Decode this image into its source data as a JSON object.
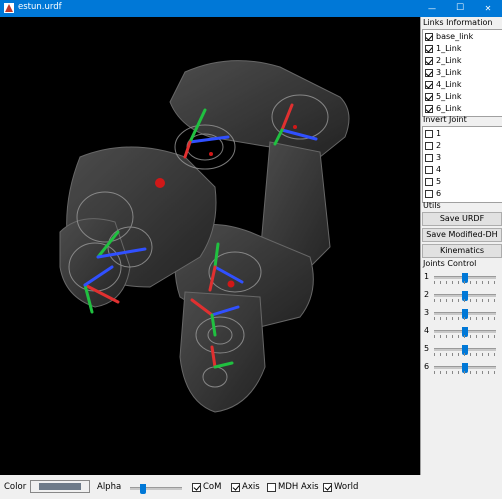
{
  "window": {
    "title": "estun.urdf",
    "minimize": "—",
    "maximize": "☐",
    "close": "✕"
  },
  "panel": {
    "links_label": "Links Information",
    "links": [
      {
        "label": "base_link",
        "checked": true
      },
      {
        "label": "1_Link",
        "checked": true
      },
      {
        "label": "2_Link",
        "checked": true
      },
      {
        "label": "3_Link",
        "checked": true
      },
      {
        "label": "4_Link",
        "checked": true
      },
      {
        "label": "5_Link",
        "checked": true
      },
      {
        "label": "6_Link",
        "checked": true
      }
    ],
    "invert_label": "Invert Joint",
    "invert": [
      {
        "label": "1",
        "checked": false
      },
      {
        "label": "2",
        "checked": false
      },
      {
        "label": "3",
        "checked": false
      },
      {
        "label": "4",
        "checked": false
      },
      {
        "label": "5",
        "checked": false
      },
      {
        "label": "6",
        "checked": false
      }
    ],
    "utils_label": "Utils",
    "save_urdf": "Save URDF",
    "save_mdh": "Save Modified-DH",
    "kinematics": "Kinematics",
    "joints_label": "Joints Control",
    "joints": [
      {
        "label": "1",
        "value": 0.5
      },
      {
        "label": "2",
        "value": 0.5
      },
      {
        "label": "3",
        "value": 0.5
      },
      {
        "label": "4",
        "value": 0.5
      },
      {
        "label": "5",
        "value": 0.5
      },
      {
        "label": "6",
        "value": 0.5
      }
    ]
  },
  "bottom": {
    "color_label": "Color",
    "color_value": "#6e7b89",
    "alpha_label": "Alpha",
    "alpha_value": 0.25,
    "com_label": "CoM",
    "com_checked": true,
    "axis_label": "Axis",
    "axis_checked": true,
    "mdh_label": "MDH Axis",
    "mdh_checked": false,
    "world_label": "World",
    "world_checked": true
  },
  "colors": {
    "titlebar": "#0078d7",
    "accent": "#0078d7",
    "viewport": "#000000"
  }
}
